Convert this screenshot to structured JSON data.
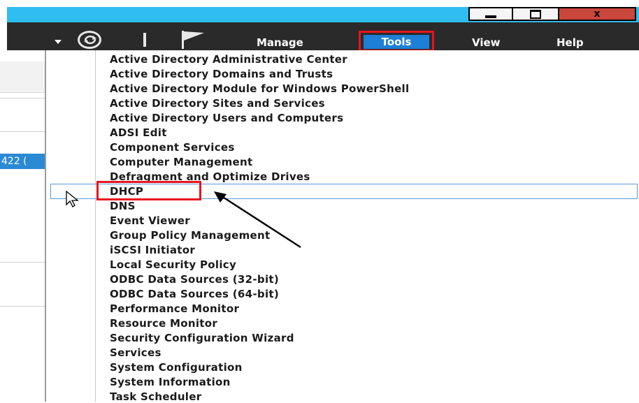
{
  "window": {
    "minimize_icon": "minimize-icon",
    "maximize_icon": "restore-icon",
    "close_label": "x"
  },
  "toolbar": {
    "icons": [
      "dropdown-arrow-icon",
      "refresh-icon",
      "flag-icon"
    ],
    "menu": {
      "manage": "Manage",
      "tools": "Tools",
      "view": "View",
      "help": "Help"
    }
  },
  "left_pane": {
    "selected_text": "422 ("
  },
  "tools_menu": {
    "items": [
      "Active Directory Administrative Center",
      "Active Directory Domains and Trusts",
      "Active Directory Module for Windows PowerShell",
      "Active Directory Sites and Services",
      "Active Directory Users and Computers",
      "ADSI Edit",
      "Component Services",
      "Computer Management",
      "Defragment and Optimize Drives",
      "DHCP",
      "DNS",
      "Event Viewer",
      "Group Policy Management",
      "iSCSI Initiator",
      "Local Security Policy",
      "ODBC Data Sources (32-bit)",
      "ODBC Data Sources (64-bit)",
      "Performance Monitor",
      "Resource Monitor",
      "Security Configuration Wizard",
      "Services",
      "System Configuration",
      "System Information",
      "Task Scheduler"
    ],
    "highlighted": "DHCP"
  },
  "colors": {
    "title_bar": "#2fbdf2",
    "toolbar": "#2a2a2a",
    "annotation_red": "#e8141d",
    "selection_blue": "#1e7fd6"
  }
}
